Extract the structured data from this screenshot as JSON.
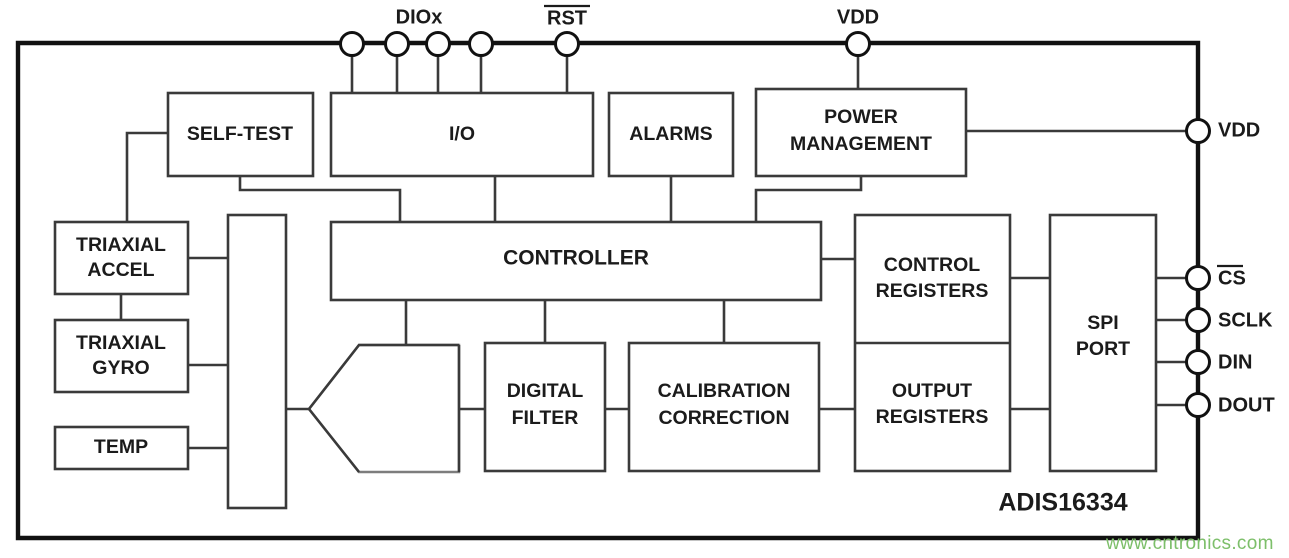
{
  "diagram": {
    "part_label": "ADIS16334",
    "watermark": "www.cntronics.com",
    "accent_color": "#1b1b1b",
    "watermark_color": "#7dbf6a",
    "border_color": "#111111",
    "block_stroke_color": "#3a3a3a"
  },
  "top_pins": [
    {
      "name": "dio-pin-1",
      "label": "",
      "group": "DIOx"
    },
    {
      "name": "dio-pin-2",
      "label": "",
      "group": "DIOx"
    },
    {
      "name": "dio-pin-3",
      "label": "",
      "group": "DIOx"
    },
    {
      "name": "dio-pin-4",
      "label": "",
      "group": "DIOx"
    },
    {
      "name": "rst-pin",
      "label": "RST",
      "group": "RST",
      "overbar": true
    },
    {
      "name": "vdd-top-pin",
      "label": "VDD",
      "group": "VDD",
      "overbar": false
    }
  ],
  "top_labels": {
    "diox": "DIOx",
    "rst": "RST",
    "vdd": "VDD"
  },
  "right_pins": [
    {
      "name": "vdd-right-pin",
      "label": "VDD",
      "overbar": false
    },
    {
      "name": "cs-pin",
      "label": "CS",
      "overbar": true
    },
    {
      "name": "sclk-pin",
      "label": "SCLK",
      "overbar": false
    },
    {
      "name": "din-pin",
      "label": "DIN",
      "overbar": false
    },
    {
      "name": "dout-pin",
      "label": "DOUT",
      "overbar": false
    }
  ],
  "blocks": {
    "self_test": "SELF-TEST",
    "io": "I/O",
    "alarms": "ALARMS",
    "power_management_line1": "POWER",
    "power_management_line2": "MANAGEMENT",
    "triaxial_accel_line1": "TRIAXIAL",
    "triaxial_accel_line2": "ACCEL",
    "triaxial_gyro_line1": "TRIAXIAL",
    "triaxial_gyro_line2": "GYRO",
    "temp": "TEMP",
    "adc_bar": "",
    "mux": "",
    "controller": "CONTROLLER",
    "digital_filter_line1": "DIGITAL",
    "digital_filter_line2": "FILTER",
    "calibration_line1": "CALIBRATION",
    "calibration_line2": "CORRECTION",
    "control_registers_line1": "CONTROL",
    "control_registers_line2": "REGISTERS",
    "output_registers_line1": "OUTPUT",
    "output_registers_line2": "REGISTERS",
    "spi_port_line1": "SPI",
    "spi_port_line2": "PORT"
  }
}
